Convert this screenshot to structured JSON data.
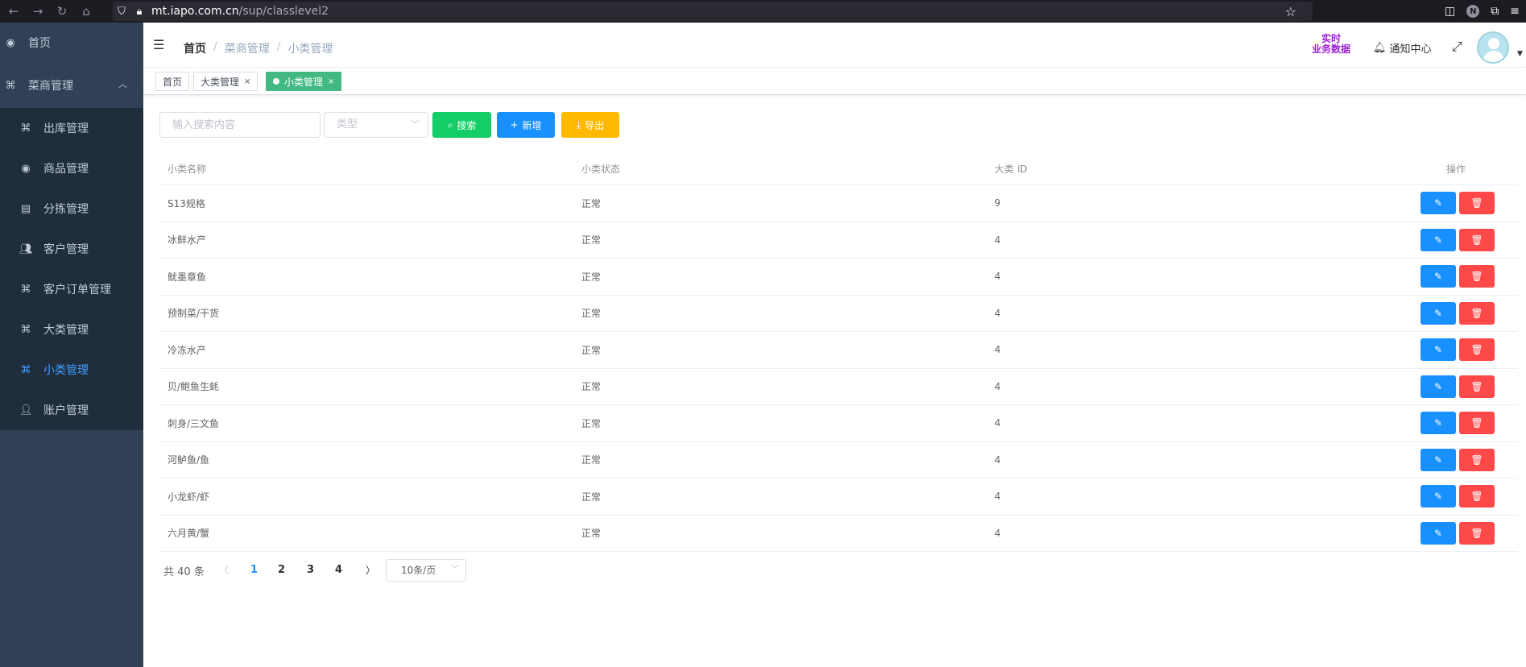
{
  "browser": {
    "url_host": "mt.iapo.com.cn",
    "url_path": "/sup/classlevel2",
    "ext_badge": "N"
  },
  "sidebar": {
    "items": [
      {
        "label": "首页",
        "icon": "dashboard-icon"
      },
      {
        "label": "菜商管理",
        "icon": "grid-icon",
        "expanded": true
      },
      {
        "label": "出库管理",
        "icon": "grid-icon"
      },
      {
        "label": "商品管理",
        "icon": "dashboard-icon"
      },
      {
        "label": "分拣管理",
        "icon": "document-icon"
      },
      {
        "label": "客户管理",
        "icon": "people-icon"
      },
      {
        "label": "客户订单管理",
        "icon": "grid-icon"
      },
      {
        "label": "大类管理",
        "icon": "grid-icon"
      },
      {
        "label": "小类管理",
        "icon": "grid-icon",
        "active": true
      },
      {
        "label": "账户管理",
        "icon": "user-icon"
      }
    ]
  },
  "header": {
    "breadcrumb": [
      "首页",
      "菜商管理",
      "小类管理"
    ],
    "realtime_line1": "实时",
    "realtime_line2": "业务数据",
    "notify_label": "通知中心"
  },
  "tags": [
    {
      "label": "首页",
      "active": false,
      "closable": false
    },
    {
      "label": "大类管理",
      "active": false,
      "closable": true
    },
    {
      "label": "小类管理",
      "active": true,
      "closable": true
    }
  ],
  "filters": {
    "search_placeholder": "输入搜索内容",
    "type_placeholder": "类型",
    "search_label": "搜索",
    "add_label": "新增",
    "export_label": "导出"
  },
  "table": {
    "columns": [
      "小类名称",
      "小类状态",
      "大类 ID",
      "操作"
    ],
    "rows": [
      {
        "name": "S13规格",
        "status": "正常",
        "parent_id": "9"
      },
      {
        "name": "冰鲜水产",
        "status": "正常",
        "parent_id": "4"
      },
      {
        "name": "鱿墨章鱼",
        "status": "正常",
        "parent_id": "4"
      },
      {
        "name": "预制菜/干货",
        "status": "正常",
        "parent_id": "4"
      },
      {
        "name": "冷冻水产",
        "status": "正常",
        "parent_id": "4"
      },
      {
        "name": "贝/鲍鱼生蚝",
        "status": "正常",
        "parent_id": "4"
      },
      {
        "name": "刺身/三文鱼",
        "status": "正常",
        "parent_id": "4"
      },
      {
        "name": "河鲈鱼/鱼",
        "status": "正常",
        "parent_id": "4"
      },
      {
        "name": "小龙虾/虾",
        "status": "正常",
        "parent_id": "4"
      },
      {
        "name": "六月黄/蟹",
        "status": "正常",
        "parent_id": "4"
      }
    ]
  },
  "pagination": {
    "total_text": "共 40 条",
    "pages": [
      "1",
      "2",
      "3",
      "4"
    ],
    "current_page": "1",
    "page_size": "10条/页"
  },
  "colors": {
    "sidebar_bg": "#304156",
    "accent_blue": "#1890ff",
    "search_green": "#13ce66",
    "export_orange": "#ffba00",
    "delete_red": "#ff4949",
    "tag_active_green": "#42b983",
    "realtime_purple": "#9b1fd6"
  }
}
